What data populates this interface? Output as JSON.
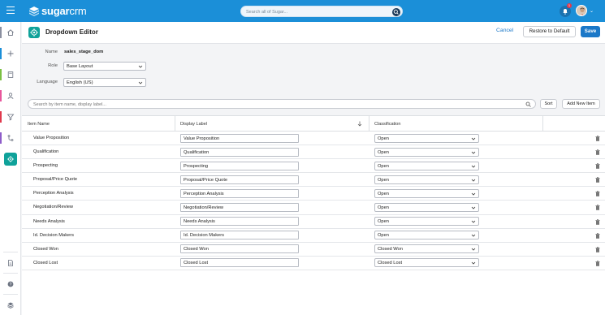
{
  "header": {
    "logo_text_bold": "sugar",
    "logo_text": "crm",
    "search_placeholder": "Search all of Sugar...",
    "notification_count": "1"
  },
  "page": {
    "title": "Dropdown Editor",
    "cancel_label": "Cancel",
    "restore_label": "Restore to Default",
    "save_label": "Save"
  },
  "form": {
    "name_label": "Name",
    "name_value": "sales_stage_dom",
    "role_label": "Role",
    "role_value": "Base Layout",
    "language_label": "Language",
    "language_value": "English (US)"
  },
  "toolbar": {
    "search_placeholder": "Search by item name, display label...",
    "sort_label": "Sort",
    "add_label": "Add New Item"
  },
  "table": {
    "columns": [
      "Item Name",
      "Display Label",
      "Classification"
    ],
    "rows": [
      {
        "name": "Value Proposition",
        "label": "Value Proposition",
        "classification": "Open"
      },
      {
        "name": "Qualification",
        "label": "Qualification",
        "classification": "Open"
      },
      {
        "name": "Prospecting",
        "label": "Prospecting",
        "classification": "Open"
      },
      {
        "name": "Proposal/Price Quote",
        "label": "Proposal/Price Quote",
        "classification": "Open"
      },
      {
        "name": "Perception Analysis",
        "label": "Perception Analysis",
        "classification": "Open"
      },
      {
        "name": "Negotiation/Review",
        "label": "Negotiation/Review",
        "classification": "Open"
      },
      {
        "name": "Needs Analysis",
        "label": "Needs Analysis",
        "classification": "Open"
      },
      {
        "name": "Id. Decision Makers",
        "label": "Id. Decision Makers",
        "classification": "Open"
      },
      {
        "name": "Closed Won",
        "label": "Closed Won",
        "classification": "Closed Won"
      },
      {
        "name": "Closed Lost",
        "label": "Closed Lost",
        "classification": "Closed Lost"
      }
    ]
  },
  "sidebar": {
    "items": [
      "home-icon",
      "plus-icon",
      "calculator-icon",
      "user-icon",
      "filter-icon",
      "route-icon",
      "gear-icon",
      "document-icon",
      "help-icon",
      "layers-icon"
    ],
    "colors": [
      "#8a8fa0",
      "#1b8fd8",
      "#7bc043",
      "#e8569c",
      "#e0394d",
      "#8e5cc9",
      "#0fa29a"
    ]
  }
}
